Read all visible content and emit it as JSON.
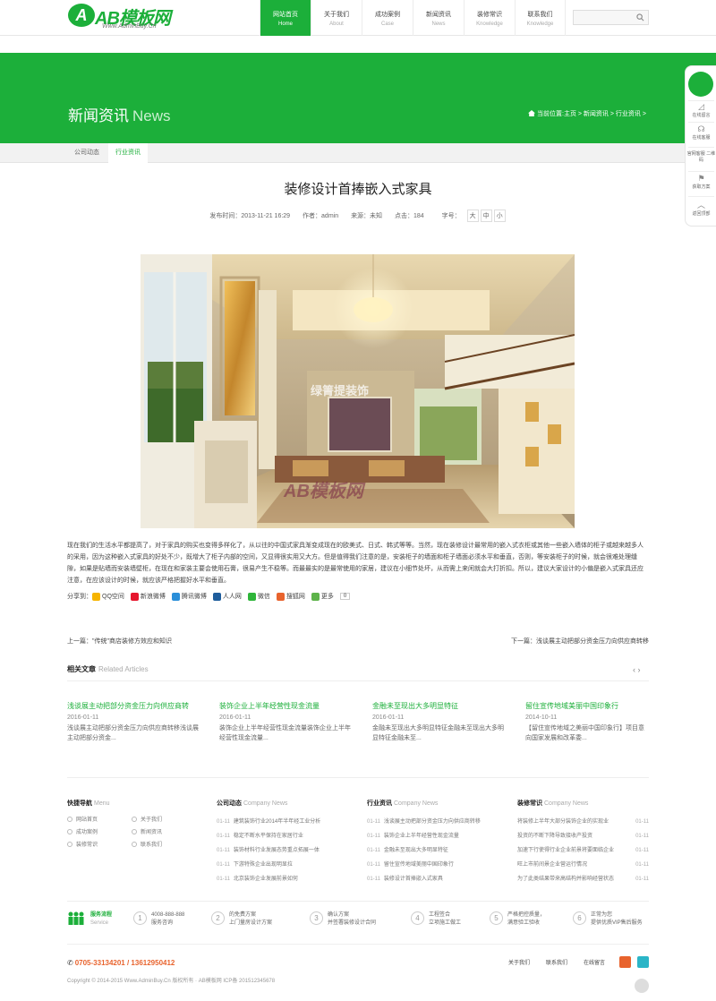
{
  "header": {
    "logo_mark": "A",
    "logo_text": "AB模板网",
    "logo_sub": "Www.AdminBuy.Cn",
    "nav": [
      {
        "label": "网站首页",
        "en": "Home",
        "active": true
      },
      {
        "label": "关于我们",
        "en": "About",
        "active": false
      },
      {
        "label": "成功案例",
        "en": "Case",
        "active": false
      },
      {
        "label": "新闻资讯",
        "en": "News",
        "active": false
      },
      {
        "label": "装修常识",
        "en": "Knowledge",
        "active": false
      },
      {
        "label": "联系我们",
        "en": "Knowledge",
        "active": false
      }
    ],
    "search_placeholder": "",
    "search_icon": "search-icon"
  },
  "banner": {
    "title": "新闻资讯",
    "title_en": "News",
    "breadcrumb": "当前位置:主页 > 新闻资讯 > 行业资讯 >"
  },
  "subtabs": [
    {
      "label": "公司动态",
      "active": false
    },
    {
      "label": "行业资讯",
      "active": true
    }
  ],
  "article": {
    "title": "装修设计首捧嵌入式家具",
    "time": "发布时间：2013-11-21 16:29",
    "author": "作者：admin",
    "source": "来源：未知",
    "clicks": "点击：184",
    "fontsize_label": "字号：",
    "fontsizes": [
      "大",
      "中",
      "小"
    ],
    "watermark1": "绿箐提装饰",
    "watermark2": "AB模板网",
    "body": "现在我们的生活水平都提高了，对于家具的购买也变得多样化了，从以往的中国式家具渐变成现在的欧美式、日式、韩式等等。当然，现在装修设计最常用的嵌入式衣柜或其他一些嵌入墙体的柜子或越来越多人的采用，因为这种嵌入式家具的好处不少，既增大了柜子内部的空间，又显得很实用又大方。但是值得我们注意的是，安装柜子的墙面和柜子墙面必须水平和垂直，否则，等安装柜子的时候，就会很难处理缝隙，如果是贴墙而安装墙壁柜，在现在和家装主要会使用石膏，很易产生不稳等。而最最实的是最常使用的家居，建议在小细节处坏，从而需上来闲就会大打折扣。所以，建议大家设计的小偏是嵌入式家具还应注意，在应该设计的时候，就应该严格把握好水平和垂直。",
    "share_label": "分享到：",
    "share": [
      {
        "label": "QQ空间",
        "color": "#f6b400"
      },
      {
        "label": "新浪微博",
        "color": "#e6162d"
      },
      {
        "label": "腾讯微博",
        "color": "#2b8fd9"
      },
      {
        "label": "人人网",
        "color": "#1f5d9c"
      },
      {
        "label": "微信",
        "color": "#2fb53a"
      },
      {
        "label": "搜狐网",
        "color": "#e8632d"
      },
      {
        "label": "更多",
        "color": "#5db34a"
      }
    ],
    "share_count": "0",
    "prev": "上一篇：\"传统\"商店装修方效应和知识",
    "next": "下一篇：浅谈展主动把部分资金压力向供应商转移"
  },
  "related": {
    "title": "相关文章",
    "title_en": "Related Articles",
    "arrows": "‹ ›",
    "items": [
      {
        "title": "浅谈展主动把部分资金压力向供应商转",
        "date": "2016-01-11",
        "excerpt": "浅谈展主动把部分资金压力向供应商转移浅谈展主动把部分资金..."
      },
      {
        "title": "装饰企业上半年经营性现金流量",
        "date": "2016-01-11",
        "excerpt": "装饰企业上半年经营性现金流量装饰企业上半年经营性现金流量..."
      },
      {
        "title": "金融未至现出大多明显特征",
        "date": "2016-01-11",
        "excerpt": "金融未至现出大多明显特征金融未至现出大多明显特征金融未至..."
      },
      {
        "title": "留住宣传地域美丽中国印象行",
        "date": "2014-10-11",
        "excerpt": "【留住宣传地域之美丽中国印象行】项目意向国家发展和改革委..."
      }
    ]
  },
  "footer": {
    "quicknav": {
      "title": "快捷导航",
      "en": "Menu",
      "links": [
        "网站首页",
        "关于我们",
        "成功案例",
        "新闻资讯",
        "装修常识",
        "联系我们"
      ]
    },
    "company_news": {
      "title": "公司动态",
      "en": "Company News",
      "rows": [
        {
          "date": "01-11",
          "text": "建筑装饰行业2014年半年经工业分析"
        },
        {
          "date": "01-11",
          "text": "稳定不断水平保持在家居行业"
        },
        {
          "date": "01-11",
          "text": "装饰材料行业发展态势重点拓展一体"
        },
        {
          "date": "01-11",
          "text": "下游特殊企业出现明显拉"
        },
        {
          "date": "01-11",
          "text": "北京装饰企业发展前景如何"
        }
      ]
    },
    "industry_news": {
      "title": "行业资讯",
      "en": "Company News",
      "rows": [
        {
          "date": "01-11",
          "text": "浅谈展主动把部分资金压力向供应商转移"
        },
        {
          "date": "01-11",
          "text": "装饰企业上半年经营性现金流量"
        },
        {
          "date": "01-11",
          "text": "金融未至现出大多明显特征"
        },
        {
          "date": "01-11",
          "text": "留住宣传地域美丽中国印象行"
        },
        {
          "date": "01-11",
          "text": "装修设计首捧嵌入式家具"
        }
      ]
    },
    "knowledge": {
      "title": "装修常识",
      "en": "Company News",
      "rows": [
        {
          "date": "01-11",
          "text": "将装修上半年大部分装饰企业的实现业"
        },
        {
          "date": "01-11",
          "text": "投资的不断下降导致接收产投资"
        },
        {
          "date": "01-11",
          "text": "加速下行使得行业企业前景将要面临企业"
        },
        {
          "date": "01-11",
          "text": "旺上市前间景企业营运行情况"
        },
        {
          "date": "01-11",
          "text": "为了此类结果带来高结构并影响经营状态"
        }
      ]
    },
    "service_label": "服务流程",
    "service_en": "Service",
    "steps": [
      {
        "num": "1",
        "l1": "4008-888-888",
        "l2": "服务咨询"
      },
      {
        "num": "2",
        "l1": "的免费方案",
        "l2": "上门量房设计方案"
      },
      {
        "num": "3",
        "l1": "确认方案",
        "l2": "并签署装修设计合同"
      },
      {
        "num": "4",
        "l1": "工程签合",
        "l2": "立项施工做工"
      },
      {
        "num": "5",
        "l1": "严格把控质量，",
        "l2": "满意验工验收"
      },
      {
        "num": "6",
        "l1": "正常为您",
        "l2": "提供优质VIP售后服务"
      }
    ],
    "phone": "0705-33134201 / 13612950412",
    "copyright": "Copyright © 2014-2015 Www.AdminBuy.Cn 版权所有 · AB模板网 ICP备 201512345678",
    "links": [
      "关于我们",
      "联系我们",
      "在线留言"
    ]
  },
  "side": [
    {
      "label": "官网"
    },
    {
      "label": "在线留言"
    },
    {
      "label": "在线客服"
    },
    {
      "label": "官网客服 二维码"
    },
    {
      "label": "获取方案"
    },
    {
      "label": "返回顶部"
    }
  ]
}
